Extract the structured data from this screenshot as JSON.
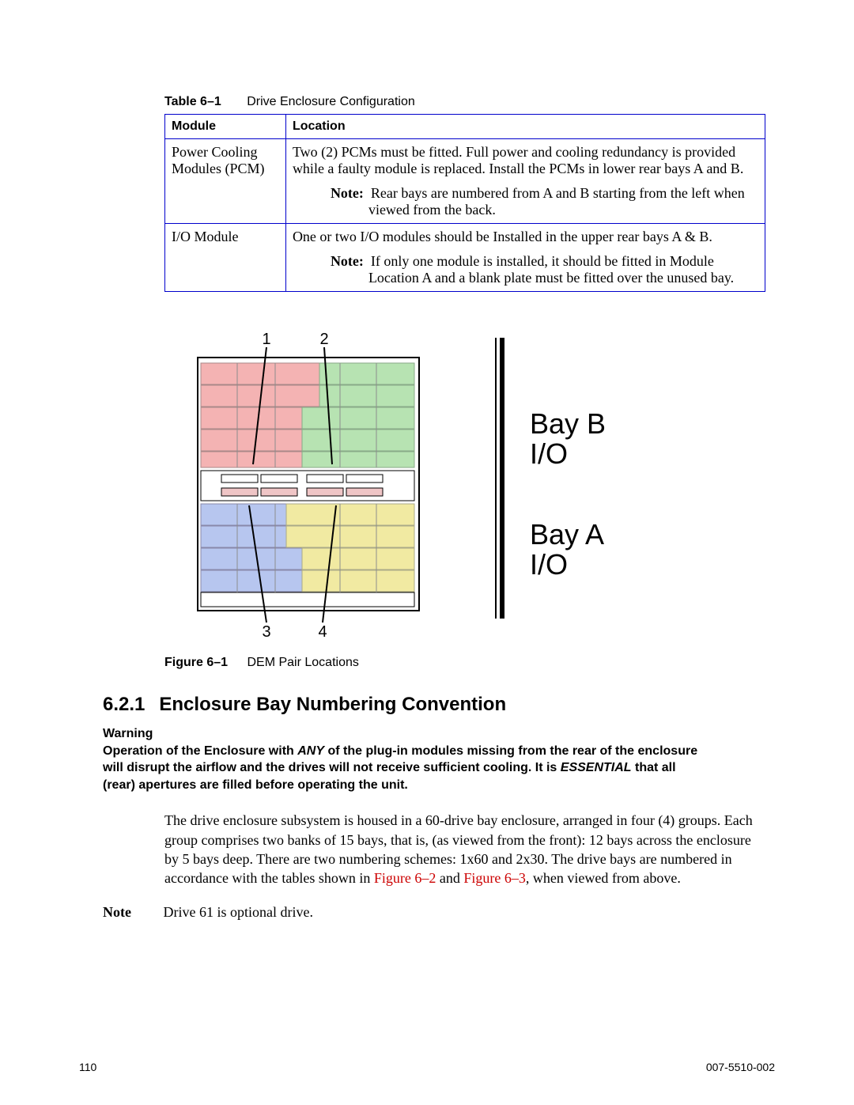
{
  "table": {
    "caption_label": "Table 6–1",
    "caption_title": "Drive Enclosure Configuration",
    "headers": {
      "module": "Module",
      "location": "Location"
    },
    "rows": [
      {
        "module": "Power Cooling Modules (PCM)",
        "location_main": "Two (2) PCMs must be fitted. Full power and cooling redundancy is provided while a faulty module is replaced. Install the PCMs in lower rear bays A and B.",
        "note_label": "Note:",
        "note_text": "Rear bays are numbered from A and B starting from the left when viewed from the back."
      },
      {
        "module": "I/O Module",
        "location_main": "One or two  I/O modules should be Installed in the upper rear bays A & B.",
        "note_label": "Note:",
        "note_text": "If only one module is installed, it should be fitted in Module Location A and a blank plate must be fitted over the unused bay."
      }
    ]
  },
  "figure": {
    "markers": {
      "1": "1",
      "2": "2",
      "3": "3",
      "4": "4"
    },
    "bayB_line1": "Bay B",
    "bayB_line2": "I/O",
    "bayA_line1": "Bay A",
    "bayA_line2": "I/O",
    "caption_label": "Figure 6–1",
    "caption_title": "DEM Pair Locations"
  },
  "section": {
    "number": "6.2.1",
    "title": "Enclosure Bay Numbering Convention"
  },
  "warning": {
    "label": "Warning",
    "text_pre": "Operation of the Enclosure with ",
    "text_any": "ANY",
    "text_mid": " of the plug-in modules missing from the rear of the enclosure will disrupt the airflow and the drives will not receive sufficient cooling. It is ",
    "text_essential": "ESSENTIAL",
    "text_post": " that all (rear) apertures are filled before operating the unit."
  },
  "body": {
    "para_pre": "The  drive enclosure subsystem is housed in a 60-drive bay enclosure, arranged in four (4) groups. Each group comprises two banks of 15 bays, that is, (as viewed from the front): 12 bays across the enclosure by 5 bays deep. There are two numbering schemes: 1x60 and 2x30. The drive bays are numbered in accordance with the tables shown in ",
    "xref1": "Figure 6–2",
    "para_mid": " and ",
    "xref2": "Figure 6–3",
    "para_post": ", when viewed from above."
  },
  "footnote": {
    "label": "Note",
    "text": "Drive 61 is optional drive."
  },
  "footer": {
    "page": "110",
    "docnum": "007-5510-002"
  }
}
